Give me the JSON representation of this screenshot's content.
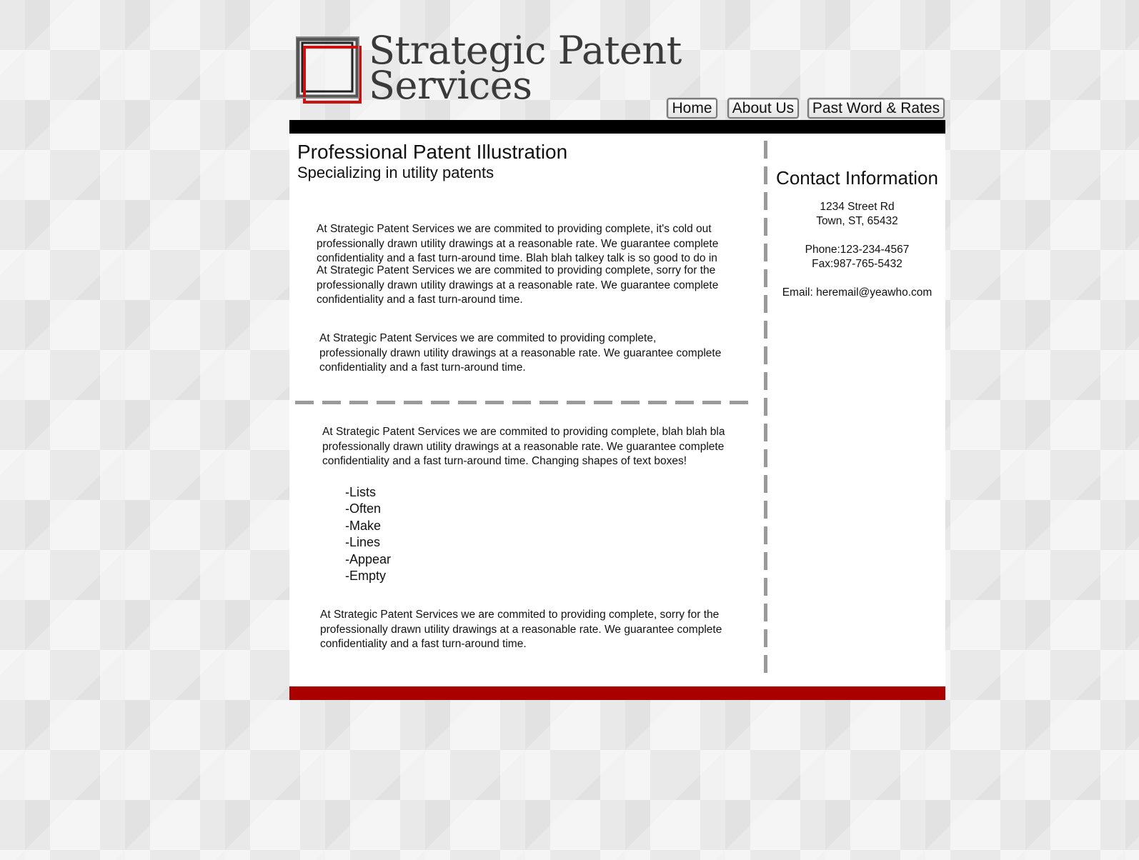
{
  "header": {
    "logo": {
      "line1": "Strategic Patent",
      "line2": "Services"
    },
    "nav": [
      {
        "label": "Home"
      },
      {
        "label": "About Us"
      },
      {
        "label": "Past Word & Rates"
      }
    ]
  },
  "main": {
    "title": "Professional Patent Illustration",
    "subtitle": "Specializing in utility patents",
    "paragraphs": [
      {
        "lines": [
          "At Strategic Patent Services we are commited to providing complete, it's cold out",
          "professionally drawn utility drawings at a reasonable rate. We guarantee complete",
          "confidentiality and a fast turn-around time. Blah blah talkey talk is so good to do in"
        ]
      },
      {
        "lines": [
          "At Strategic Patent Services we are commited to providing complete, sorry for the",
          "professionally drawn utility drawings at a reasonable rate. We guarantee complete",
          "confidentiality and a fast turn-around time."
        ]
      },
      {
        "lines": [
          "At Strategic Patent Services we are commited to providing complete,",
          "professionally drawn utility drawings at a reasonable rate. We guarantee complete",
          "confidentiality and a fast turn-around time."
        ]
      },
      {
        "lines": [
          "At Strategic Patent Services we are commited to providing complete, blah blah bla",
          "professionally drawn utility drawings at a reasonable rate. We guarantee complete",
          "confidentiality and a fast turn-around time. Changing shapes of text boxes!"
        ]
      },
      {
        "lines": [
          "At Strategic Patent Services we are commited to providing complete, sorry for the",
          "professionally drawn utility drawings at a reasonable rate. We guarantee complete",
          "confidentiality and a fast turn-around time."
        ]
      }
    ],
    "list": [
      "-Lists",
      "-Often",
      "-Make",
      "-Lines",
      "-Appear",
      "-Empty"
    ]
  },
  "contact": {
    "title": "Contact Information",
    "street": "1234 Street Rd",
    "city": "Town, ST, 65432",
    "phone": "Phone:123-234-4567",
    "fax": "Fax:987-765-5432",
    "email": "Email: heremail@yeawho.com"
  },
  "colors": {
    "top_bar": "#000000",
    "bottom_bar": "#aa0000",
    "logo_accent": "#cc1111",
    "divider": "#9a9a9a"
  }
}
